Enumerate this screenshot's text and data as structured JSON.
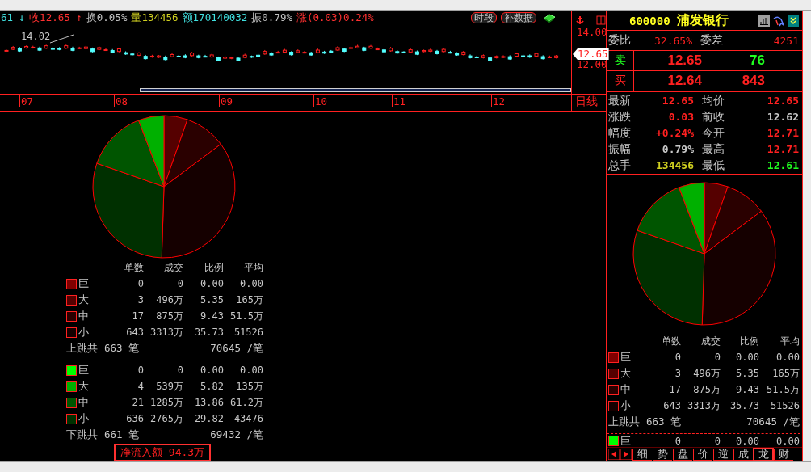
{
  "quote_bar": {
    "items": [
      {
        "text": "61 ↓",
        "color": "#40e0e0"
      },
      {
        "text": "收12.65 ↑",
        "color": "#ff3030"
      },
      {
        "text": "换0.05%",
        "color": "#c0c0c0"
      },
      {
        "text": "量134456",
        "color": "#d0d020"
      },
      {
        "text": "额170140032",
        "color": "#40e0e0"
      },
      {
        "text": "振0.79%",
        "color": "#c0c0c0"
      },
      {
        "text": "涨(0.03)0.24%",
        "color": "#ff3030"
      }
    ],
    "buttons": [
      {
        "label": "时段"
      },
      {
        "label": "补数据"
      }
    ]
  },
  "chart": {
    "high_label": "14.02",
    "y_labels": [
      "14.00",
      "12.00"
    ],
    "price_tag": "12.65",
    "x_labels": [
      "07",
      "08",
      "09",
      "10",
      "11",
      "12"
    ],
    "period": "日线"
  },
  "flow_panel": {
    "columns": [
      "单数",
      "成交",
      "比例",
      "平均"
    ],
    "up": {
      "rows": [
        {
          "label": "巨",
          "color": "#800000",
          "count": "0",
          "amount": "0",
          "ratio": "0.00",
          "avg": "0.00"
        },
        {
          "label": "大",
          "color": "#550000",
          "count": "3",
          "amount": "496万",
          "ratio": "5.35",
          "avg": "165万"
        },
        {
          "label": "中",
          "color": "#2a0000",
          "count": "17",
          "amount": "875万",
          "ratio": "9.43",
          "avg": "51.5万"
        },
        {
          "label": "小",
          "color": "#150000",
          "count": "643",
          "amount": "3313万",
          "ratio": "35.73",
          "avg": "51526"
        }
      ],
      "summary": {
        "label": "上跳共",
        "count": "663 笔",
        "avg": "70645 /笔"
      }
    },
    "down": {
      "rows": [
        {
          "label": "巨",
          "color": "#00ff00",
          "count": "0",
          "amount": "0",
          "ratio": "0.00",
          "avg": "0.00"
        },
        {
          "label": "大",
          "color": "#00b000",
          "count": "4",
          "amount": "539万",
          "ratio": "5.82",
          "avg": "135万"
        },
        {
          "label": "中",
          "color": "#005500",
          "count": "21",
          "amount": "1285万",
          "ratio": "13.86",
          "avg": "61.2万"
        },
        {
          "label": "小",
          "color": "#003000",
          "count": "636",
          "amount": "2765万",
          "ratio": "29.82",
          "avg": "43476"
        }
      ],
      "summary": {
        "label": "下跳共",
        "count": "661 笔",
        "avg": "69432 /笔"
      }
    },
    "net_inflow": "净流入额 94.3万"
  },
  "quote_panel": {
    "code": "600000",
    "name": "浦发银行",
    "ratio": {
      "label": "委比",
      "value": "32.65%",
      "label2": "委差",
      "value2": "4251"
    },
    "orders": [
      {
        "label": "卖",
        "color": "#20ff20",
        "price": "12.65",
        "volume": "76"
      },
      {
        "label": "买",
        "color": "#ff2020",
        "price": "12.64",
        "volume": "843"
      }
    ],
    "stats": [
      {
        "cells": [
          {
            "label": "最新",
            "value": "12.65",
            "color": "#ff2020"
          },
          {
            "label": "均价",
            "value": "12.65",
            "color": "#ff2020"
          }
        ]
      },
      {
        "cells": [
          {
            "label": "涨跌",
            "value": "0.03",
            "color": "#ff2020"
          },
          {
            "label": "前收",
            "value": "12.62",
            "color": "#c8c8c8"
          }
        ]
      },
      {
        "cells": [
          {
            "label": "幅度",
            "value": "+0.24%",
            "color": "#ff2020"
          },
          {
            "label": "今开",
            "value": "12.71",
            "color": "#ff2020"
          }
        ]
      },
      {
        "cells": [
          {
            "label": "振幅",
            "value": "0.79%",
            "color": "#c8c8c8"
          },
          {
            "label": "最高",
            "value": "12.71",
            "color": "#ff2020"
          }
        ]
      },
      {
        "cells": [
          {
            "label": "总手",
            "value": "134456",
            "color": "#d0d020"
          },
          {
            "label": "最低",
            "value": "12.61",
            "color": "#20ff20"
          }
        ]
      }
    ],
    "flow": {
      "columns": [
        "单数",
        "成交",
        "比例",
        "平均"
      ],
      "up": {
        "rows": [
          {
            "label": "巨",
            "color": "#800000",
            "count": "0",
            "amount": "0",
            "ratio": "0.00",
            "avg": "0.00"
          },
          {
            "label": "大",
            "color": "#550000",
            "count": "3",
            "amount": "496万",
            "ratio": "5.35",
            "avg": "165万"
          },
          {
            "label": "中",
            "color": "#2a0000",
            "count": "17",
            "amount": "875万",
            "ratio": "9.43",
            "avg": "51.5万"
          },
          {
            "label": "小",
            "color": "#150000",
            "count": "643",
            "amount": "3313万",
            "ratio": "35.73",
            "avg": "51526"
          }
        ],
        "summary": {
          "label": "上跳共",
          "count": "663 笔",
          "avg": "70645 /笔"
        }
      },
      "down_rows": [
        {
          "label": "巨",
          "color": "#00ff00",
          "count": "0",
          "amount": "0",
          "ratio": "0.00",
          "avg": "0.00"
        }
      ]
    },
    "tabs": [
      {
        "label": "细",
        "highlighted": false
      },
      {
        "label": "势",
        "highlighted": false
      },
      {
        "label": "盘",
        "highlighted": false
      },
      {
        "label": "价",
        "highlighted": false
      },
      {
        "label": "逆",
        "highlighted": false
      },
      {
        "label": "成",
        "highlighted": false
      },
      {
        "label": "龙",
        "highlighted": true
      },
      {
        "label": "财",
        "highlighted": false
      }
    ]
  }
}
